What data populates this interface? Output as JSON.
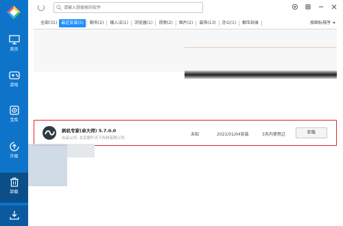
{
  "sidebar": {
    "items": [
      {
        "label": "首页",
        "icon": "monitor-icon"
      },
      {
        "label": "游戏",
        "icon": "gamepad-icon"
      },
      {
        "label": "宝库",
        "icon": "treasure-icon"
      },
      {
        "label": "升级",
        "icon": "upgrade-icon"
      },
      {
        "label": "卸载",
        "icon": "trash-icon",
        "active": true
      }
    ],
    "bottom_icon": "download-icon"
  },
  "search": {
    "placeholder": "请输入想搜索的软件"
  },
  "tabs": [
    {
      "label": "全部(31)"
    },
    {
      "label": "最近安装(5)",
      "active": true
    },
    {
      "label": "聊天(2)"
    },
    {
      "label": "输入法(1)"
    },
    {
      "label": "浏览器(1)"
    },
    {
      "label": "视频(2)"
    },
    {
      "label": "图片(2)"
    },
    {
      "label": "装饰(13)"
    },
    {
      "label": "办公(1)"
    },
    {
      "label": "解压刻录"
    }
  ],
  "sort_label": "按图标排序",
  "app": {
    "name": "刷机专家(卓大师) 5.7.0.0",
    "publisher": "出品公司: 北京顺升天下科技有限公司",
    "size": "未知",
    "date": "2021/01/04安装",
    "usage": "3天内使用过",
    "uninstall_label": "卸载"
  },
  "colors": {
    "sidebar": "#0e74c9",
    "accent": "#1e90ff",
    "highlight": "#e02424"
  }
}
